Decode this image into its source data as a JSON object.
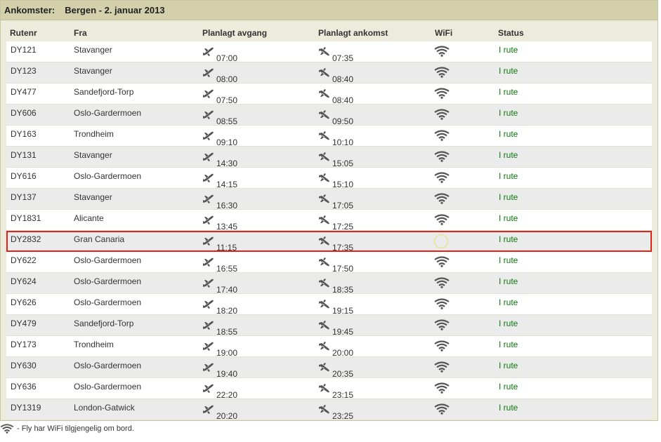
{
  "title": {
    "label": "Ankomster:",
    "location": "Bergen - 2. januar 2013"
  },
  "columns": {
    "route": "Rutenr",
    "from": "Fra",
    "departure": "Planlagt avgang",
    "arrival": "Planlagt ankomst",
    "wifi": "WiFi",
    "status": "Status"
  },
  "flights": [
    {
      "route": "DY121",
      "from": "Stavanger",
      "departure": "07:00",
      "arrival": "07:35",
      "status": "I rute"
    },
    {
      "route": "DY123",
      "from": "Stavanger",
      "departure": "08:00",
      "arrival": "08:40",
      "status": "I rute"
    },
    {
      "route": "DY477",
      "from": "Sandefjord-Torp",
      "departure": "07:50",
      "arrival": "08:40",
      "status": "I rute"
    },
    {
      "route": "DY606",
      "from": "Oslo-Gardermoen",
      "departure": "08:55",
      "arrival": "09:50",
      "status": "I rute"
    },
    {
      "route": "DY163",
      "from": "Trondheim",
      "departure": "09:10",
      "arrival": "10:10",
      "status": "I rute"
    },
    {
      "route": "DY131",
      "from": "Stavanger",
      "departure": "14:30",
      "arrival": "15:05",
      "status": "I rute"
    },
    {
      "route": "DY616",
      "from": "Oslo-Gardermoen",
      "departure": "14:15",
      "arrival": "15:10",
      "status": "I rute"
    },
    {
      "route": "DY137",
      "from": "Stavanger",
      "departure": "16:30",
      "arrival": "17:05",
      "status": "I rute"
    },
    {
      "route": "DY1831",
      "from": "Alicante",
      "departure": "13:45",
      "arrival": "17:25",
      "status": "I rute"
    },
    {
      "route": "DY2832",
      "from": "Gran Canaria",
      "departure": "11:15",
      "arrival": "17:35",
      "status": "I rute",
      "highlighted": true,
      "wifi_icon": "cursor-ring"
    },
    {
      "route": "DY622",
      "from": "Oslo-Gardermoen",
      "departure": "16:55",
      "arrival": "17:50",
      "status": "I rute"
    },
    {
      "route": "DY624",
      "from": "Oslo-Gardermoen",
      "departure": "17:40",
      "arrival": "18:35",
      "status": "I rute"
    },
    {
      "route": "DY626",
      "from": "Oslo-Gardermoen",
      "departure": "18:20",
      "arrival": "19:15",
      "status": "I rute"
    },
    {
      "route": "DY479",
      "from": "Sandefjord-Torp",
      "departure": "18:55",
      "arrival": "19:45",
      "status": "I rute"
    },
    {
      "route": "DY173",
      "from": "Trondheim",
      "departure": "19:00",
      "arrival": "20:00",
      "status": "I rute"
    },
    {
      "route": "DY630",
      "from": "Oslo-Gardermoen",
      "departure": "19:40",
      "arrival": "20:35",
      "status": "I rute"
    },
    {
      "route": "DY636",
      "from": "Oslo-Gardermoen",
      "departure": "22:20",
      "arrival": "23:15",
      "status": "I rute"
    },
    {
      "route": "DY1319",
      "from": "London-Gatwick",
      "departure": "20:20",
      "arrival": "23:25",
      "status": "I rute"
    }
  ],
  "icons": {
    "departure": "plane-takeoff-icon",
    "arrival": "plane-landing-icon",
    "wifi": "wifi-icon"
  },
  "footer": {
    "legend": "- Fly har WiFi tilgjengelig om bord."
  },
  "colors": {
    "title_bar": "#d3d0ab",
    "panel": "#ecebdc",
    "status_green": "#0a7a0a",
    "highlight_red": "#e2231a"
  }
}
